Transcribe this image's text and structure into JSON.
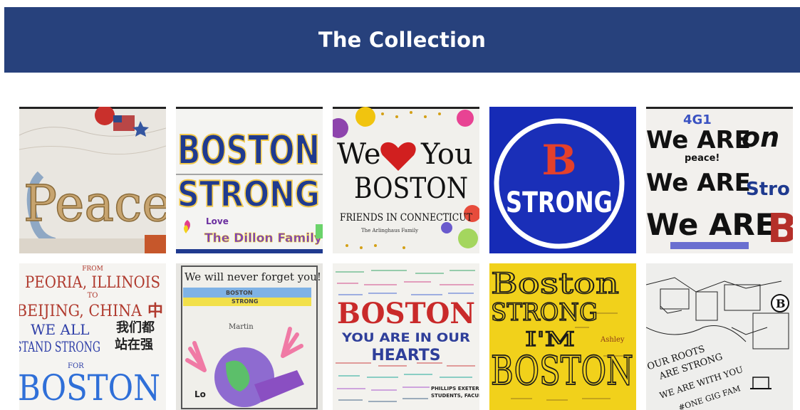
{
  "header": {
    "title": "The Collection"
  },
  "colors": {
    "header_bg": "#27417c",
    "page_bg": "#ffffff"
  },
  "tiles": [
    {
      "lines": [
        "Peace"
      ]
    },
    {
      "lines": [
        "BOSTON",
        "STRONG",
        "Love",
        "The Dillon Family"
      ]
    },
    {
      "lines": [
        "We",
        "You",
        "BOSTON",
        "FRIENDS IN CONNECTICUT",
        "The Arlinghaus Family"
      ]
    },
    {
      "lines": [
        "B",
        "STRONG"
      ]
    },
    {
      "lines": [
        "4G1",
        "We ARE",
        "peace!",
        "on",
        "We ARE",
        "Stro",
        "We ARE",
        "B"
      ]
    },
    {
      "lines": [
        "FROM",
        "PEORIA, ILLINOIS",
        "TO",
        "BEIJING, CHINA",
        "中",
        "WE ALL",
        "STAND STRONG",
        "我们都",
        "站在强",
        "FOR",
        "BOSTON"
      ]
    },
    {
      "lines": [
        "We will never forget you!",
        "BOSTON",
        "STRONG",
        "Martin"
      ]
    },
    {
      "lines": [
        "BOSTON",
        "YOU ARE IN OUR",
        "HEARTS",
        "PHILLIPS EXETER A",
        "STUDENTS, FACULTY &"
      ]
    },
    {
      "lines": [
        "Boston",
        "STRONG",
        "I'M",
        "BOSTON",
        "Ashley"
      ]
    },
    {
      "lines": [
        "OUR ROOTS",
        "ARE STRONG",
        "WE ARE WITH YOU",
        "#ONE GIG FAM",
        "B"
      ]
    }
  ]
}
